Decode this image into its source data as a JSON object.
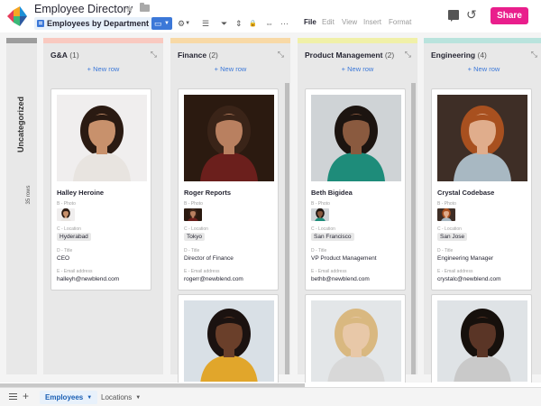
{
  "app": {
    "title": "Employee Directory",
    "view_label": "Employees by Department",
    "menu": [
      "File",
      "Edit",
      "View",
      "Insert",
      "Format"
    ],
    "share_label": "Share",
    "icons": [
      "star-icon",
      "folder-icon",
      "comment-icon",
      "history-icon"
    ]
  },
  "toolbar": {
    "gear": "⚙",
    "list": "☰",
    "filter": "⏷",
    "sort": "⇕",
    "lock": "🔒",
    "more": "···"
  },
  "board": {
    "uncategorized": {
      "label": "Uncategorized",
      "rows": "35 rows"
    },
    "columns": [
      {
        "name": "G&A",
        "count": "(1)",
        "color": "#f9c9c0",
        "new_row": "+ New row",
        "cards": [
          {
            "name": "Halley Heroine",
            "photo_label": "B - Photo",
            "location_label": "C - Location",
            "location": "Hyderabad",
            "title_label": "D - Title",
            "title": "CEO",
            "email_label": "E - Email address",
            "email": "halleyh@newblend.com",
            "skin": "#c8916c",
            "hair": "#2a1a12",
            "bg": "#f0eeee",
            "shirt": "#e8e4e0"
          }
        ]
      },
      {
        "name": "Finance",
        "count": "(2)",
        "color": "#f8d9a6",
        "new_row": "+ New row",
        "cards": [
          {
            "name": "Roger Reports",
            "photo_label": "B - Photo",
            "location_label": "C - Location",
            "location": "Tokyo",
            "title_label": "D - Title",
            "title": "Director of Finance",
            "email_label": "E - Email address",
            "email": "rogerr@newblend.com",
            "skin": "#b98060",
            "hair": "#3a2418",
            "bg": "#2b1a10",
            "shirt": "#6b1f1c"
          },
          {
            "skin": "#6a3f2a",
            "hair": "#1b1210",
            "bg": "#d9e0e6",
            "shirt": "#e1a62b"
          }
        ]
      },
      {
        "name": "Product Management",
        "count": "(2)",
        "color": "#f0f0a8",
        "new_row": "+ New row",
        "cards": [
          {
            "name": "Beth Bigidea",
            "photo_label": "B - Photo",
            "location_label": "C - Location",
            "location": "San Francisco",
            "title_label": "D - Title",
            "title": "VP Product Management",
            "email_label": "E - Email address",
            "email": "bethb@newblend.com",
            "skin": "#8a5a3f",
            "hair": "#1c1410",
            "bg": "#cfd3d6",
            "shirt": "#1e8c7a"
          },
          {
            "skin": "#e8c8a8",
            "hair": "#d9b880",
            "bg": "#e3e6e8",
            "shirt": "#d8d8d8"
          }
        ]
      },
      {
        "name": "Engineering",
        "count": "(4)",
        "color": "#b9e3dd",
        "new_row": "+ New row",
        "cards": [
          {
            "name": "Crystal Codebase",
            "photo_label": "B - Photo",
            "location_label": "C - Location",
            "location": "San Jose",
            "title_label": "D - Title",
            "title": "Engineering Manager",
            "email_label": "E - Email address",
            "email": "crystalc@newblend.com",
            "skin": "#e0ad8c",
            "hair": "#a8501f",
            "bg": "#3e2e26",
            "shirt": "#a8b8c2"
          },
          {
            "skin": "#5a3526",
            "hair": "#16100c",
            "bg": "#dfe3e6",
            "shirt": "#c9c9c9"
          }
        ]
      }
    ]
  },
  "bottom": {
    "tabs": [
      {
        "label": "Employees",
        "active": true
      },
      {
        "label": "Locations",
        "active": false
      }
    ]
  }
}
